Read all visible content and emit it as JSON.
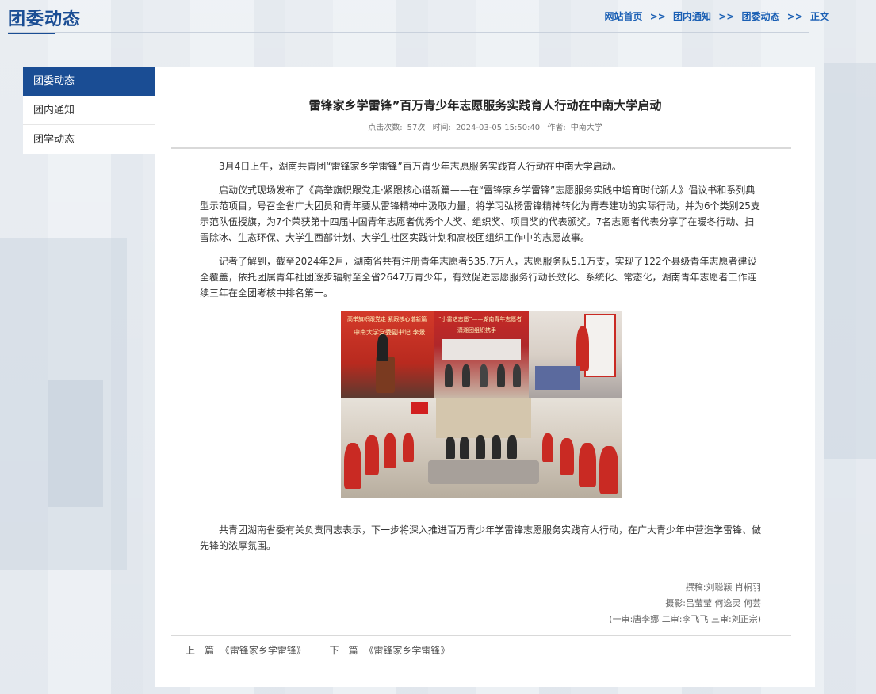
{
  "header": {
    "title": "团委动态",
    "breadcrumb": [
      "网站首页",
      "团内通知",
      "团委动态",
      "正文"
    ],
    "breadcrumb_sep": ">>"
  },
  "sidebar": {
    "items": [
      {
        "label": "团委动态",
        "active": true
      },
      {
        "label": "团内通知",
        "active": false
      },
      {
        "label": "团学动态",
        "active": false
      }
    ]
  },
  "article": {
    "title": "雷锋家乡学雷锋”百万青少年志愿服务实践育人行动在中南大学启动",
    "meta": {
      "views_label": "点击次数:",
      "views": "57次",
      "time_label": "时间:",
      "time": "2024-03-05 15:50:40",
      "author_label": "作者:",
      "author": "中南大学"
    },
    "paragraphs": [
      "3月4日上午，湖南共青团“雷锋家乡学雷锋”百万青少年志愿服务实践育人行动在中南大学启动。",
      "启动仪式现场发布了《高举旗帜跟党走·紧跟核心谱新篇——在“雷锋家乡学雷锋”志愿服务实践中培育时代新人》倡议书和系列典型示范项目，号召全省广大团员和青年要从雷锋精神中汲取力量，将学习弘扬雷锋精神转化为青春建功的实际行动，并为6个类别25支示范队伍授旗，为7个荣获第十四届中国青年志愿者优秀个人奖、组织奖、项目奖的代表颁奖。7名志愿者代表分享了在暖冬行动、扫雪除冰、生态环保、大学生西部计划、大学生社区实践计划和高校团组织工作中的志愿故事。",
      "记者了解到，截至2024年2月，湖南省共有注册青年志愿者535.7万人，志愿服务队5.1万支，实现了122个县级青年志愿者建设全覆盖，依托团属青年社团逐步辐射至全省2647万青少年，有效促进志愿服务行动长效化、系统化、常态化，湖南青年志愿者工作连续三年在全团考核中排名第一。"
    ],
    "photo_captions": {
      "banner_1": "高举旗帜跟党走 紧跟核心谱新篇",
      "banner_1b": "中南大学党委副书记 李景",
      "banner_2": "“小雷达志愿”——湖南青年志愿者",
      "banner_2b": "潇湘团组织携手"
    },
    "closing_paragraph": "共青团湖南省委有关负责同志表示，下一步将深入推进百万青少年学雷锋志愿服务实践育人行动，在广大青少年中营造学雷锋、做先锋的浓厚氛围。",
    "credits": {
      "writer": "撰稿:刘聪颖 肖桐羽",
      "photo": "摄影:吕莹莹 何逸灵 何芸",
      "review": "(一审:唐李娜 二审:李飞飞 三审:刘正宗)"
    },
    "prev": {
      "label": "上一篇",
      "title": "《雷锋家乡学雷锋》"
    },
    "next": {
      "label": "下一篇",
      "title": "《雷锋家乡学雷锋》"
    }
  },
  "colors": {
    "brand": "#1a4d94",
    "link": "#1a5fb4",
    "page_bg": "#e4e9ef"
  }
}
